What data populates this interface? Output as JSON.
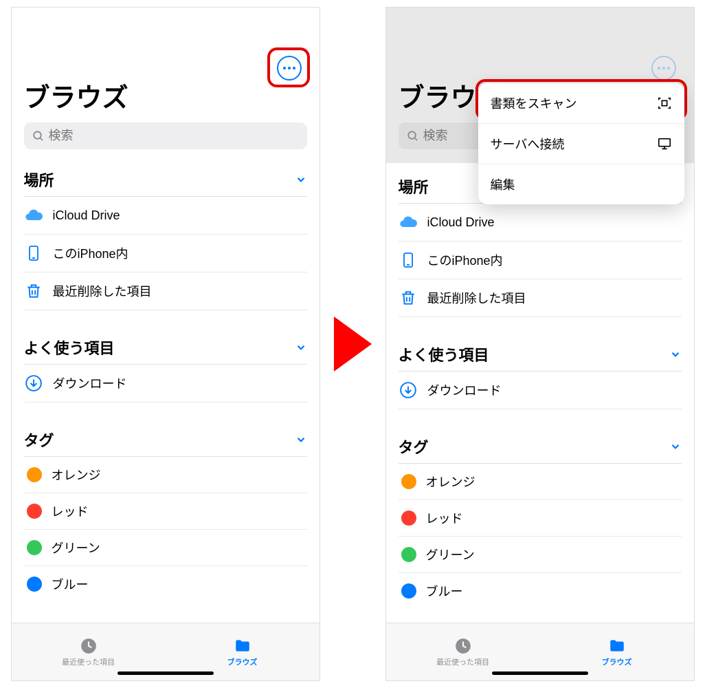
{
  "title": "ブラウズ",
  "search": {
    "placeholder": "検索"
  },
  "sections": {
    "locations": {
      "header": "場所",
      "items": [
        {
          "label": "iCloud Drive"
        },
        {
          "label": "このiPhone内"
        },
        {
          "label": "最近削除した項目"
        }
      ]
    },
    "favorites": {
      "header": "よく使う項目",
      "items": [
        {
          "label": "ダウンロード"
        }
      ]
    },
    "tags": {
      "header": "タグ",
      "items": [
        {
          "label": "オレンジ",
          "color": "#ff9500"
        },
        {
          "label": "レッド",
          "color": "#ff3b30"
        },
        {
          "label": "グリーン",
          "color": "#34c759"
        },
        {
          "label": "ブルー",
          "color": "#007aff"
        }
      ]
    }
  },
  "tabbar": {
    "recent": "最近使った項目",
    "browse": "ブラウズ"
  },
  "popup": {
    "scan": "書類をスキャン",
    "connect": "サーバへ接続",
    "edit": "編集"
  }
}
